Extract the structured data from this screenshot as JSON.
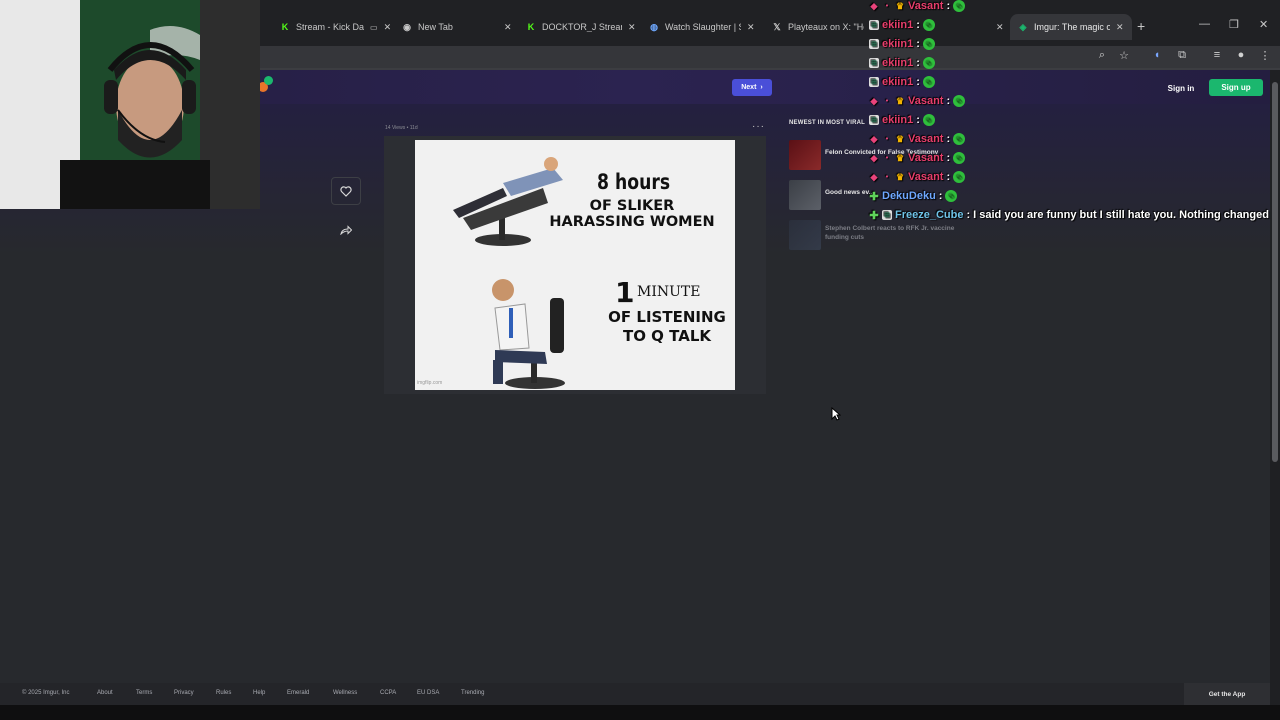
{
  "browser": {
    "tabs": [
      {
        "label": "Stream - Kick Da",
        "icon": "kick-icon",
        "active": false
      },
      {
        "label": "New Tab",
        "icon": "chrome-icon",
        "active": false
      },
      {
        "label": "DOCKTOR_J Stream",
        "icon": "kick-icon",
        "active": false
      },
      {
        "label": "Watch Slaughter | Stre",
        "icon": "globe-icon",
        "active": false
      },
      {
        "label": "Playteaux on X: \"Holy",
        "icon": "x-icon",
        "active": false
      },
      {
        "label": "Imgur: The magic of",
        "icon": "imgur-icon",
        "active": true
      }
    ],
    "new_tab": "+"
  },
  "header": {
    "next_label": "Next",
    "signin_label": "Sign in",
    "signup_label": "Sign up"
  },
  "post": {
    "meta": "14 Views • 11d",
    "meme": {
      "line1": "8 hours",
      "line2": "OF SLIKER HARASSING WOMEN",
      "line3_number": "1",
      "line3_word": "MINUTE",
      "line4": "OF LISTENING TO Q TALK",
      "watermark": "imgflip.com"
    }
  },
  "sidebar": {
    "title": "NEWEST IN MOST VIRAL",
    "items": [
      {
        "text": "Felon Convicted for False Testimony",
        "dim": false
      },
      {
        "text": "Good news ev...",
        "dim": false
      },
      {
        "text": "Stephen Colbert reacts to RFK Jr. vaccine funding cuts",
        "dim": true
      }
    ]
  },
  "footer": {
    "links": [
      "© 2025 Imgur, Inc",
      "About",
      "Terms",
      "Privacy",
      "Rules",
      "Help",
      "Emerald",
      "Wellness",
      "CCPA",
      "EU DSA",
      "Trending"
    ],
    "get_app": "Get the App"
  },
  "chat": {
    "lines": [
      {
        "user": "Vasant",
        "color": "#e83e6c",
        "badges": [
          "cube",
          "dot",
          "crown"
        ],
        "message": ""
      },
      {
        "user": "ekiin1",
        "color": "#e83e6c",
        "badges": [
          "sub"
        ],
        "message": ""
      },
      {
        "user": "ekiin1",
        "color": "#e83e6c",
        "badges": [
          "sub"
        ],
        "message": ""
      },
      {
        "user": "ekiin1",
        "color": "#e83e6c",
        "badges": [
          "sub"
        ],
        "message": ""
      },
      {
        "user": "ekiin1",
        "color": "#e83e6c",
        "badges": [
          "sub"
        ],
        "message": ""
      },
      {
        "user": "Vasant",
        "color": "#e83e6c",
        "badges": [
          "cube",
          "dot",
          "crown"
        ],
        "message": ""
      },
      {
        "user": "ekiin1",
        "color": "#e83e6c",
        "badges": [
          "sub"
        ],
        "message": ""
      },
      {
        "user": "Vasant",
        "color": "#e83e6c",
        "badges": [
          "cube",
          "dot",
          "crown"
        ],
        "message": ""
      },
      {
        "user": "Vasant",
        "color": "#e83e6c",
        "badges": [
          "cube",
          "dot",
          "crown"
        ],
        "message": ""
      },
      {
        "user": "Vasant",
        "color": "#e83e6c",
        "badges": [
          "cube",
          "dot",
          "crown"
        ],
        "message": ""
      },
      {
        "user": "DekuDeku",
        "color": "#6fa8ff",
        "badges": [
          "plus"
        ],
        "message": ""
      },
      {
        "user": "Freeze_Cube",
        "color": "#6fc3e8",
        "badges": [
          "plus",
          "sub"
        ],
        "message": "I said you are funny but I still hate you. Nothing changed"
      }
    ]
  },
  "colors": {
    "accent_next": "#4a4fd8",
    "signup_green": "#1bb76e",
    "page_bg": "#27292d"
  }
}
